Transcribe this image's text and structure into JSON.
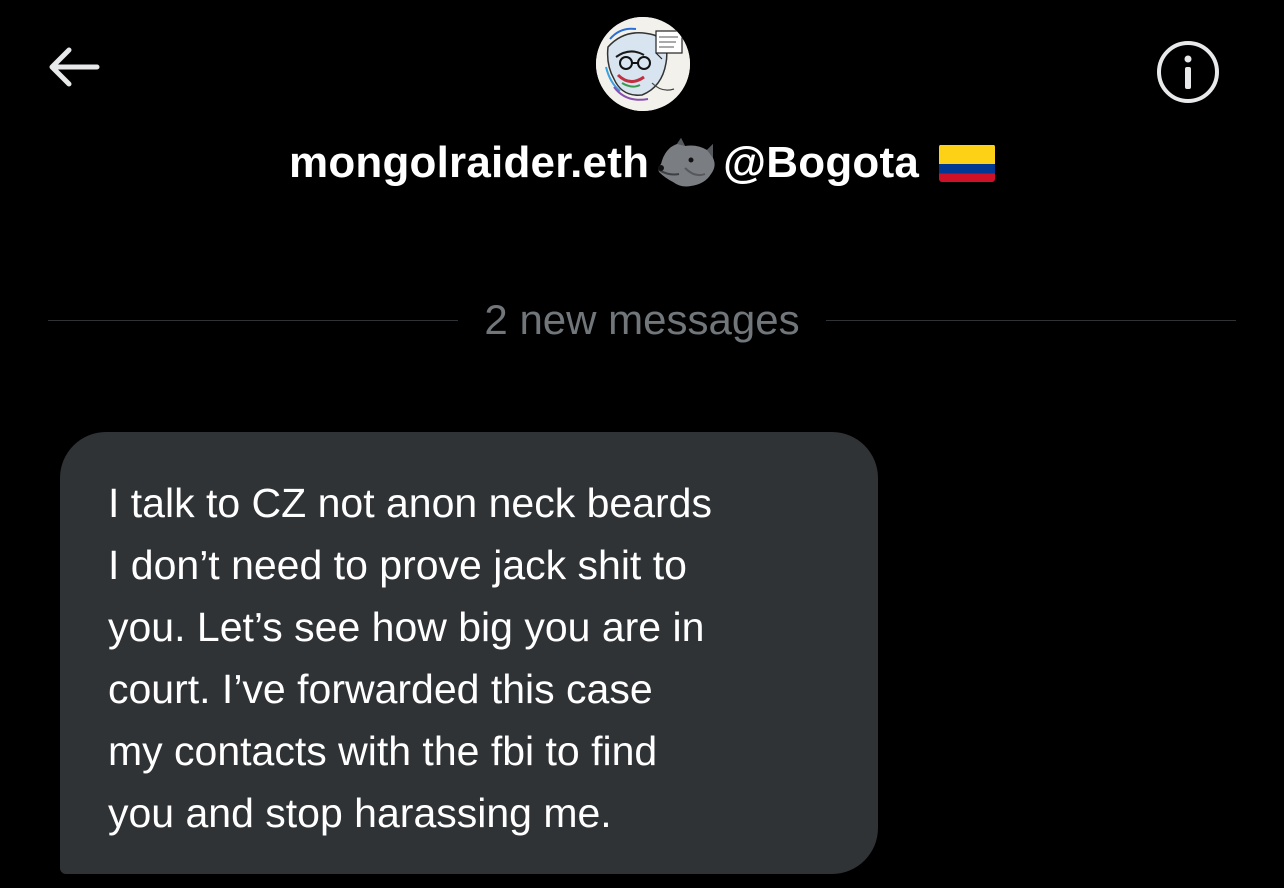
{
  "header": {
    "display_name": "mongolraider.eth",
    "handle_suffix": "@Bogota",
    "back_icon": "arrow-left-icon",
    "info_icon": "info-circle-icon",
    "wolf_emoji_icon": "wolf-emoji-icon",
    "flag_icon": "colombia-flag-icon"
  },
  "conversation": {
    "divider_label": "2 new messages",
    "messages": [
      {
        "text": "I talk to CZ not anon neck beards\nI don’t need to prove jack shit to\nyou. Let’s see how big you are in\ncourt. I’ve forwarded this case\nmy contacts with the fbi to find\nyou and stop harassing me."
      }
    ]
  },
  "colors": {
    "background": "#000000",
    "bubble": "#2f3336",
    "divider_text": "#71767b",
    "primary_text": "#ffffff"
  }
}
